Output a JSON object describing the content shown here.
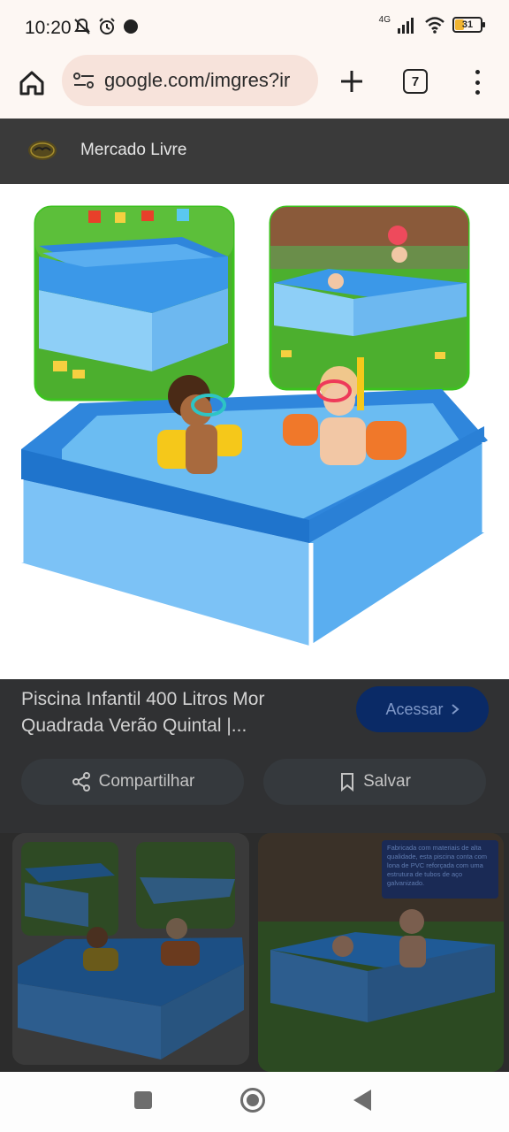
{
  "status_bar": {
    "time": "10:20",
    "network": "4G",
    "battery": "31",
    "icons": [
      "mute-icon",
      "alarm-icon",
      "record-dot-icon",
      "signal-icon",
      "wifi-icon",
      "battery-icon"
    ]
  },
  "browser": {
    "url": "google.com/imgres?ir",
    "tab_count": "7",
    "icons": [
      "home-icon",
      "site-settings-icon",
      "plus-icon",
      "tabs-icon",
      "more-vert-icon"
    ]
  },
  "site": {
    "name": "Mercado Livre"
  },
  "result": {
    "title": "Piscina Infantil 400 Litros Mor Quadrada Verão Quintal |...",
    "visit_label": "Acessar",
    "share_label": "Compartilhar",
    "save_label": "Salvar"
  },
  "related": {
    "caption": "Fabricada com materiais de alta qualidade, esta piscina conta com lona de PVC reforçada com uma estrutura de tubos de aço galvanizado."
  },
  "colors": {
    "status_bg": "#fdf7f3",
    "url_bg": "#f7e3db",
    "header_bg": "#3a3a3a",
    "pool_blue": "#6db8f0",
    "pool_rim": "#2f86dc",
    "grass": "#4caf2e"
  }
}
